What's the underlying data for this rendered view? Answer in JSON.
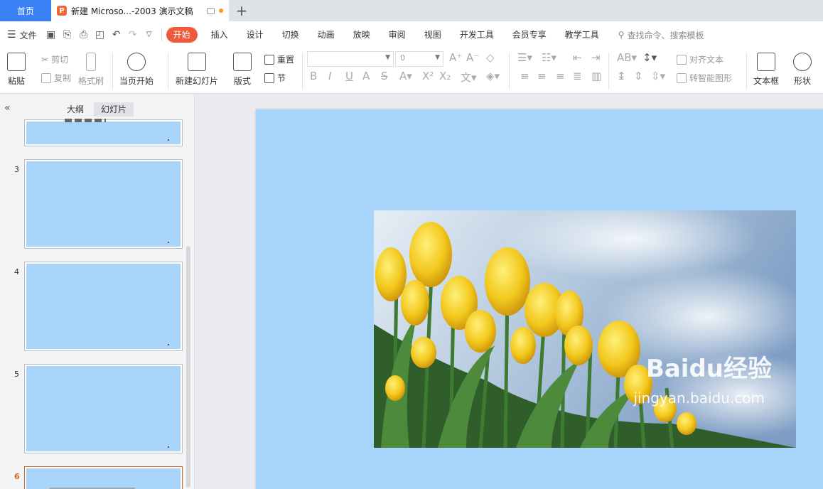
{
  "tabs": {
    "home": "首页",
    "document": "新建 Microso...-2003 演示文稿"
  },
  "menu": {
    "file": "文件",
    "items": [
      "开始",
      "插入",
      "设计",
      "切换",
      "动画",
      "放映",
      "审阅",
      "视图",
      "开发工具",
      "会员专享",
      "教学工具"
    ],
    "search_placeholder": "查找命令、搜索模板"
  },
  "ribbon": {
    "paste": "粘贴",
    "cut": "剪切",
    "copy": "复制",
    "format_painter": "格式刷",
    "from_current": "当页开始",
    "new_slide": "新建幻灯片",
    "layout": "版式",
    "reset": "重置",
    "section": "节",
    "font_size": "0",
    "align_text": "对齐文本",
    "smartart": "转智能图形",
    "textbox": "文本框",
    "shape": "形状"
  },
  "panel": {
    "outline_tab": "大纲",
    "slides_tab": "幻灯片",
    "slide_numbers": [
      "3",
      "4",
      "5",
      "6"
    ]
  },
  "watermark": {
    "brand": "Baidu经验",
    "url": "jingyan.baidu.com"
  },
  "colors": {
    "accent": "#ee5a3a",
    "home_tab": "#3a80f5",
    "slide_bg": "#a6d4fa"
  }
}
